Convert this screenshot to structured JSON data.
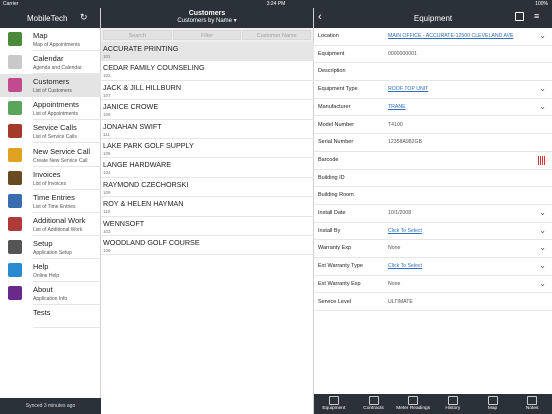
{
  "status": {
    "carrier": "Carrier",
    "time": "3:24 PM",
    "battery": "100%"
  },
  "left": {
    "title": "MobileTech",
    "footer": "Synced 3 minutes ago",
    "menu": [
      {
        "label": "Map",
        "sub": "Map of Appointments",
        "icon": "map-icon",
        "color": "#4a8a3a"
      },
      {
        "label": "Calendar",
        "sub": "Agenda and Calendar",
        "icon": "calendar-icon",
        "color": "#c9c9c9"
      },
      {
        "label": "Customers",
        "sub": "List of Customers",
        "icon": "customers-icon",
        "color": "#c24a8f"
      },
      {
        "label": "Appointments",
        "sub": "List of Appointments",
        "icon": "appointments-icon",
        "color": "#5aa55a"
      },
      {
        "label": "Service Calls",
        "sub": "List of Service Calls",
        "icon": "wrench-icon",
        "color": "#a33b2a"
      },
      {
        "label": "New Service Call",
        "sub": "Create New Service Call",
        "icon": "truck-icon",
        "color": "#e0a220"
      },
      {
        "label": "Invoices",
        "sub": "List of Invoices",
        "icon": "invoice-icon",
        "color": "#6a4a20"
      },
      {
        "label": "Time Entries",
        "sub": "List of Time Entries",
        "icon": "clock-icon",
        "color": "#3a6db0"
      },
      {
        "label": "Additional Work",
        "sub": "List of Additional Work",
        "icon": "additional-work-icon",
        "color": "#b03a3a"
      },
      {
        "label": "Setup",
        "sub": "Application Setup",
        "icon": "gear-icon",
        "color": "#555555"
      },
      {
        "label": "Help",
        "sub": "Online Help",
        "icon": "help-icon",
        "color": "#2a8ad0"
      },
      {
        "label": "About",
        "sub": "Application Info",
        "icon": "about-icon",
        "color": "#6a2a8a"
      },
      {
        "label": "Tests",
        "sub": "",
        "icon": "",
        "color": ""
      }
    ]
  },
  "mid": {
    "title": "Customers",
    "subtitle": "Customers by Name ▾",
    "segments": [
      "Search",
      "Filter",
      "Customer Name"
    ],
    "customers": [
      {
        "name": "ACCURATE PRINTING",
        "num": "101"
      },
      {
        "name": "CEDAR FAMILY COUNSELING",
        "num": "102"
      },
      {
        "name": "JACK & JILL HILLBURN",
        "num": "107"
      },
      {
        "name": "JANICE CROWE",
        "num": "108"
      },
      {
        "name": "JONAHAN SWIFT",
        "num": "111"
      },
      {
        "name": "LAKE PARK GOLF SUPPLY",
        "num": "105"
      },
      {
        "name": "LANGE HARDWARE",
        "num": "104"
      },
      {
        "name": "RAYMOND CZECHORSKI",
        "num": "109"
      },
      {
        "name": "ROY & HELEN HAYMAN",
        "num": "110"
      },
      {
        "name": "WENNSOFT",
        "num": "103"
      },
      {
        "name": "WOODLAND GOLF COURSE",
        "num": "106"
      }
    ]
  },
  "right": {
    "title": "Equipment",
    "fields": [
      {
        "key": "Location",
        "value": "MAIN OFFICE - ACCURATE-12500 CLEVELAND AVE",
        "link": true,
        "chev": true
      },
      {
        "key": "Equipment",
        "value": "0000000001",
        "link": false,
        "chev": false
      },
      {
        "key": "Description",
        "value": "",
        "link": false,
        "chev": false
      },
      {
        "key": "Equipment Type",
        "value": "ROOF TOP UNIT",
        "link": true,
        "chev": true
      },
      {
        "key": "Manufacturer",
        "value": "TRANE",
        "link": true,
        "chev": true
      },
      {
        "key": "Model Number",
        "value": "T4100",
        "link": false,
        "chev": false
      },
      {
        "key": "Serial Number",
        "value": "12358A982GB",
        "link": false,
        "chev": false
      },
      {
        "key": "Barcode",
        "value": "",
        "link": false,
        "chev": false,
        "barcode": true
      },
      {
        "key": "Building ID",
        "value": "",
        "link": false,
        "chev": false
      },
      {
        "key": "Building Room",
        "value": "",
        "link": false,
        "chev": false
      },
      {
        "key": "Install Date",
        "value": "10/1/2008",
        "link": false,
        "chev": true
      },
      {
        "key": "Install By",
        "value": "Click To Select",
        "link": true,
        "chev": true
      },
      {
        "key": "Warranty Exp",
        "value": "None",
        "link": false,
        "chev": true
      },
      {
        "key": "Ext Warranty Type",
        "value": "Click To Select",
        "link": true,
        "chev": true
      },
      {
        "key": "Ext Warranty Exp",
        "value": "None",
        "link": false,
        "chev": true
      },
      {
        "key": "Service Level",
        "value": "ULTIMATE",
        "link": false,
        "chev": false
      }
    ],
    "tabs": [
      "Equipment",
      "Contracts",
      "Meter Readings",
      "History",
      "Map",
      "Notes"
    ]
  }
}
